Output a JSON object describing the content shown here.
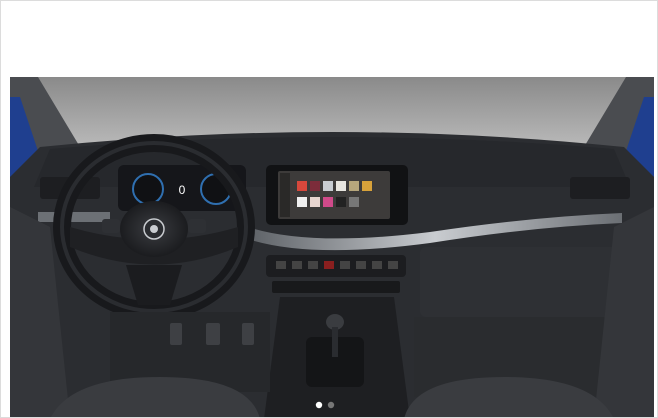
{
  "image": {
    "subject": "car-dashboard-interior-photo",
    "colors": {
      "background": "#ffffff",
      "sky": "#9a9a9a",
      "dash": "#2b2d31",
      "trim": "#8c9096",
      "body_blue": "#1f3f8f",
      "seat": "#3a3c40"
    }
  },
  "cluster": {
    "speed": "0"
  },
  "slider": {
    "dots": 2,
    "active": 1
  }
}
